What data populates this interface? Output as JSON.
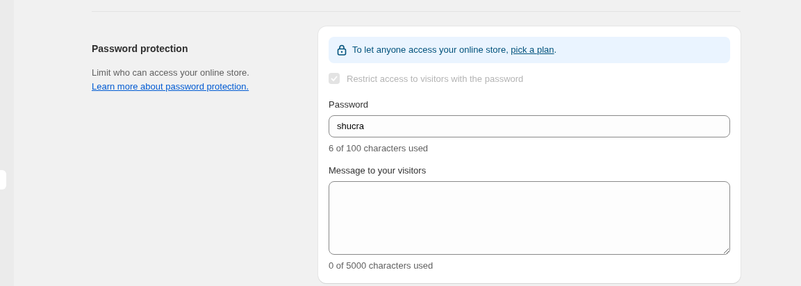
{
  "section": {
    "title": "Password protection",
    "description": "Limit who can access your online store. ",
    "link": "Learn more about password protection."
  },
  "banner": {
    "text_before": "To let anyone access your online store, ",
    "link": "pick a plan",
    "text_after": "."
  },
  "restrict": {
    "label": "Restrict access to visitors with the password",
    "checked": true,
    "disabled": true
  },
  "password": {
    "label": "Password",
    "value": "shucra",
    "helper": "6 of 100 characters used"
  },
  "message": {
    "label": "Message to your visitors",
    "helper": "0 of 5000 characters used"
  }
}
